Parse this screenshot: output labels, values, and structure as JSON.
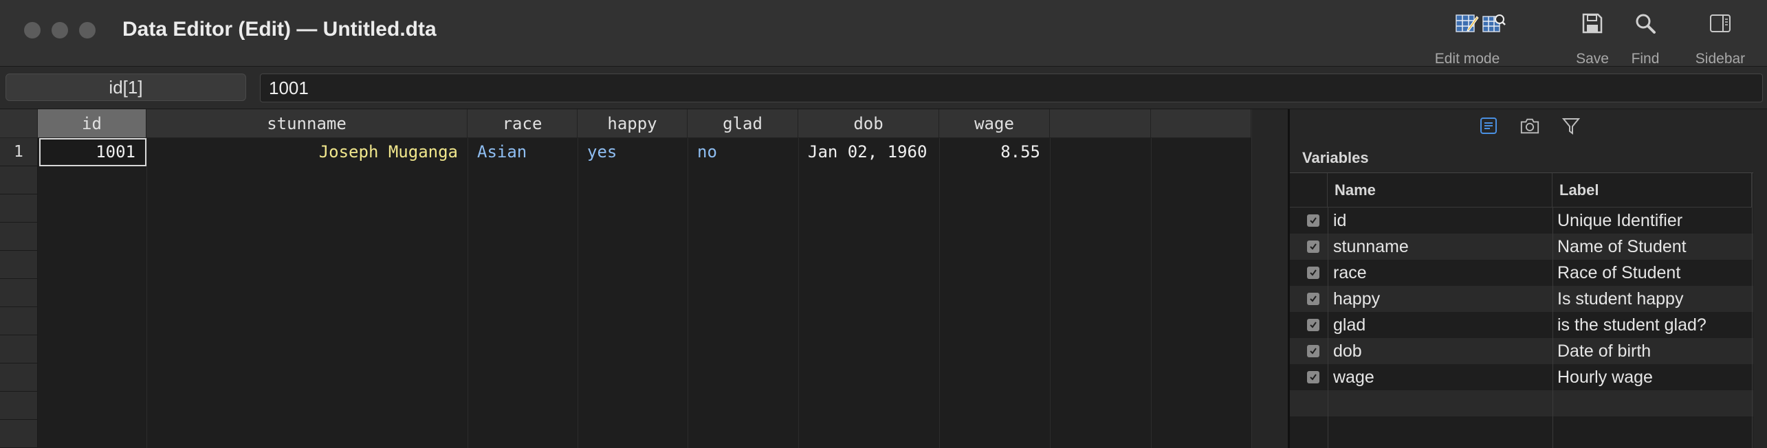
{
  "window": {
    "title": "Data Editor (Edit) — Untitled.dta"
  },
  "toolbar": {
    "edit_mode_label": "Edit mode",
    "save_label": "Save",
    "find_label": "Find",
    "sidebar_label": "Sidebar"
  },
  "editbar": {
    "cell_ref": "id[1]",
    "cell_value": "1001"
  },
  "grid": {
    "columns": [
      "id",
      "stunname",
      "race",
      "happy",
      "glad",
      "dob",
      "wage"
    ],
    "row_number": "1",
    "row": {
      "id": "1001",
      "stunname": "Joseph Muganga",
      "race": "Asian",
      "happy": "yes",
      "glad": "no",
      "dob": "Jan 02, 1960",
      "wage": "8.55"
    },
    "colors": {
      "string": "#f0e68c",
      "labeled": "#8fbef2",
      "numeric": "#f0f0f0"
    }
  },
  "sidebar": {
    "section_title": "Variables",
    "name_header": "Name",
    "label_header": "Label",
    "variables": [
      {
        "name": "id",
        "label": "Unique Identifier"
      },
      {
        "name": "stunname",
        "label": "Name of Student"
      },
      {
        "name": "race",
        "label": "Race of Student"
      },
      {
        "name": "happy",
        "label": "Is student happy"
      },
      {
        "name": "glad",
        "label": "is the student glad?"
      },
      {
        "name": "dob",
        "label": "Date of birth"
      },
      {
        "name": "wage",
        "label": "Hourly wage"
      }
    ],
    "accent": "#4a90e2"
  }
}
